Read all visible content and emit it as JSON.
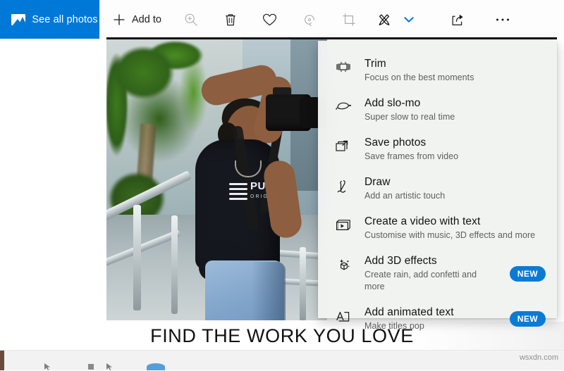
{
  "app": {
    "accent_color": "#0078d7",
    "badge_color": "#0a7bd4"
  },
  "commandbar": {
    "see_all_photos": {
      "label": "See all photos",
      "icon": "photos-library-icon"
    },
    "add_to": {
      "label": "Add to",
      "icon": "plus-icon"
    },
    "buttons": [
      {
        "name": "zoom-in-button",
        "icon": "magnifier-plus-icon",
        "enabled": false
      },
      {
        "name": "delete-button",
        "icon": "trash-icon",
        "enabled": true
      },
      {
        "name": "favorite-button",
        "icon": "heart-icon",
        "enabled": true
      },
      {
        "name": "rotate-button",
        "icon": "rotate-icon",
        "enabled": false
      },
      {
        "name": "crop-button",
        "icon": "crop-icon",
        "enabled": false
      },
      {
        "name": "edit-create-button",
        "icon": "edit-create-icon",
        "enabled": true
      },
      {
        "name": "edit-create-chevron",
        "icon": "chevron-down-icon",
        "enabled": true
      },
      {
        "name": "share-button",
        "icon": "share-icon",
        "enabled": true
      },
      {
        "name": "more-options-button",
        "icon": "ellipsis-icon",
        "enabled": true
      }
    ]
  },
  "menu": {
    "items": [
      {
        "title": "Trim",
        "subtitle": "Focus on the best moments",
        "icon": "trim-icon",
        "badge": ""
      },
      {
        "title": "Add slo-mo",
        "subtitle": "Super slow to real time",
        "icon": "turtle-icon",
        "badge": ""
      },
      {
        "title": "Save photos",
        "subtitle": "Save frames from video",
        "icon": "save-photos-icon",
        "badge": ""
      },
      {
        "title": "Draw",
        "subtitle": "Add an artistic touch",
        "icon": "pen-icon",
        "badge": ""
      },
      {
        "title": "Create a video with text",
        "subtitle": "Customise with music, 3D effects and more",
        "icon": "video-text-icon",
        "badge": ""
      },
      {
        "title": "Add 3D effects",
        "subtitle": "Create rain, add confetti and more",
        "icon": "cube-sparkle-icon",
        "badge": "NEW"
      },
      {
        "title": "Add animated text",
        "subtitle": "Make titles pop",
        "icon": "animated-text-icon",
        "badge": "NEW"
      }
    ]
  },
  "photo": {
    "caption": "FIND THE WORK YOU LOVE",
    "tee_word": "PU",
    "tee_sub": "ORIGINAL"
  },
  "watermark": {
    "text": "wsxdn.com"
  }
}
